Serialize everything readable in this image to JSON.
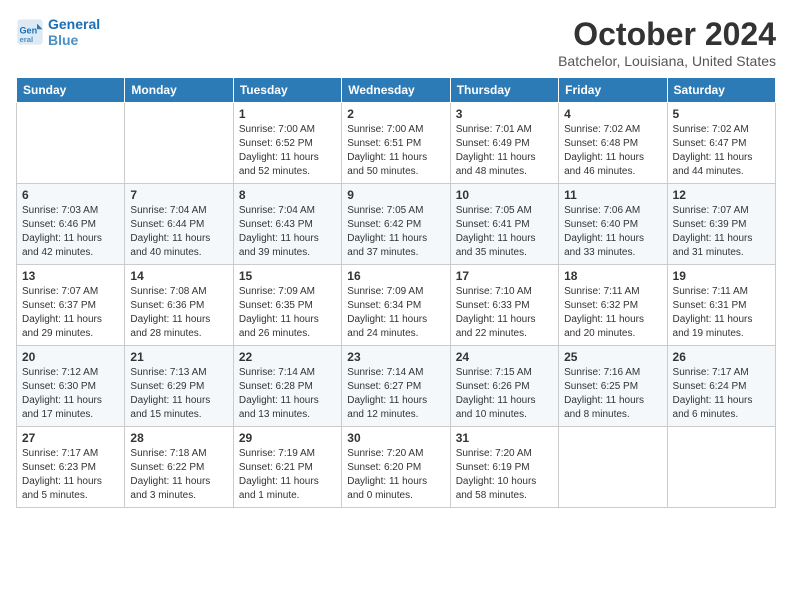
{
  "header": {
    "logo_line1": "General",
    "logo_line2": "Blue",
    "month": "October 2024",
    "location": "Batchelor, Louisiana, United States"
  },
  "days_of_week": [
    "Sunday",
    "Monday",
    "Tuesday",
    "Wednesday",
    "Thursday",
    "Friday",
    "Saturday"
  ],
  "weeks": [
    [
      {
        "day": "",
        "info": ""
      },
      {
        "day": "",
        "info": ""
      },
      {
        "day": "1",
        "info": "Sunrise: 7:00 AM\nSunset: 6:52 PM\nDaylight: 11 hours\nand 52 minutes."
      },
      {
        "day": "2",
        "info": "Sunrise: 7:00 AM\nSunset: 6:51 PM\nDaylight: 11 hours\nand 50 minutes."
      },
      {
        "day": "3",
        "info": "Sunrise: 7:01 AM\nSunset: 6:49 PM\nDaylight: 11 hours\nand 48 minutes."
      },
      {
        "day": "4",
        "info": "Sunrise: 7:02 AM\nSunset: 6:48 PM\nDaylight: 11 hours\nand 46 minutes."
      },
      {
        "day": "5",
        "info": "Sunrise: 7:02 AM\nSunset: 6:47 PM\nDaylight: 11 hours\nand 44 minutes."
      }
    ],
    [
      {
        "day": "6",
        "info": "Sunrise: 7:03 AM\nSunset: 6:46 PM\nDaylight: 11 hours\nand 42 minutes."
      },
      {
        "day": "7",
        "info": "Sunrise: 7:04 AM\nSunset: 6:44 PM\nDaylight: 11 hours\nand 40 minutes."
      },
      {
        "day": "8",
        "info": "Sunrise: 7:04 AM\nSunset: 6:43 PM\nDaylight: 11 hours\nand 39 minutes."
      },
      {
        "day": "9",
        "info": "Sunrise: 7:05 AM\nSunset: 6:42 PM\nDaylight: 11 hours\nand 37 minutes."
      },
      {
        "day": "10",
        "info": "Sunrise: 7:05 AM\nSunset: 6:41 PM\nDaylight: 11 hours\nand 35 minutes."
      },
      {
        "day": "11",
        "info": "Sunrise: 7:06 AM\nSunset: 6:40 PM\nDaylight: 11 hours\nand 33 minutes."
      },
      {
        "day": "12",
        "info": "Sunrise: 7:07 AM\nSunset: 6:39 PM\nDaylight: 11 hours\nand 31 minutes."
      }
    ],
    [
      {
        "day": "13",
        "info": "Sunrise: 7:07 AM\nSunset: 6:37 PM\nDaylight: 11 hours\nand 29 minutes."
      },
      {
        "day": "14",
        "info": "Sunrise: 7:08 AM\nSunset: 6:36 PM\nDaylight: 11 hours\nand 28 minutes."
      },
      {
        "day": "15",
        "info": "Sunrise: 7:09 AM\nSunset: 6:35 PM\nDaylight: 11 hours\nand 26 minutes."
      },
      {
        "day": "16",
        "info": "Sunrise: 7:09 AM\nSunset: 6:34 PM\nDaylight: 11 hours\nand 24 minutes."
      },
      {
        "day": "17",
        "info": "Sunrise: 7:10 AM\nSunset: 6:33 PM\nDaylight: 11 hours\nand 22 minutes."
      },
      {
        "day": "18",
        "info": "Sunrise: 7:11 AM\nSunset: 6:32 PM\nDaylight: 11 hours\nand 20 minutes."
      },
      {
        "day": "19",
        "info": "Sunrise: 7:11 AM\nSunset: 6:31 PM\nDaylight: 11 hours\nand 19 minutes."
      }
    ],
    [
      {
        "day": "20",
        "info": "Sunrise: 7:12 AM\nSunset: 6:30 PM\nDaylight: 11 hours\nand 17 minutes."
      },
      {
        "day": "21",
        "info": "Sunrise: 7:13 AM\nSunset: 6:29 PM\nDaylight: 11 hours\nand 15 minutes."
      },
      {
        "day": "22",
        "info": "Sunrise: 7:14 AM\nSunset: 6:28 PM\nDaylight: 11 hours\nand 13 minutes."
      },
      {
        "day": "23",
        "info": "Sunrise: 7:14 AM\nSunset: 6:27 PM\nDaylight: 11 hours\nand 12 minutes."
      },
      {
        "day": "24",
        "info": "Sunrise: 7:15 AM\nSunset: 6:26 PM\nDaylight: 11 hours\nand 10 minutes."
      },
      {
        "day": "25",
        "info": "Sunrise: 7:16 AM\nSunset: 6:25 PM\nDaylight: 11 hours\nand 8 minutes."
      },
      {
        "day": "26",
        "info": "Sunrise: 7:17 AM\nSunset: 6:24 PM\nDaylight: 11 hours\nand 6 minutes."
      }
    ],
    [
      {
        "day": "27",
        "info": "Sunrise: 7:17 AM\nSunset: 6:23 PM\nDaylight: 11 hours\nand 5 minutes."
      },
      {
        "day": "28",
        "info": "Sunrise: 7:18 AM\nSunset: 6:22 PM\nDaylight: 11 hours\nand 3 minutes."
      },
      {
        "day": "29",
        "info": "Sunrise: 7:19 AM\nSunset: 6:21 PM\nDaylight: 11 hours\nand 1 minute."
      },
      {
        "day": "30",
        "info": "Sunrise: 7:20 AM\nSunset: 6:20 PM\nDaylight: 11 hours\nand 0 minutes."
      },
      {
        "day": "31",
        "info": "Sunrise: 7:20 AM\nSunset: 6:19 PM\nDaylight: 10 hours\nand 58 minutes."
      },
      {
        "day": "",
        "info": ""
      },
      {
        "day": "",
        "info": ""
      }
    ]
  ]
}
